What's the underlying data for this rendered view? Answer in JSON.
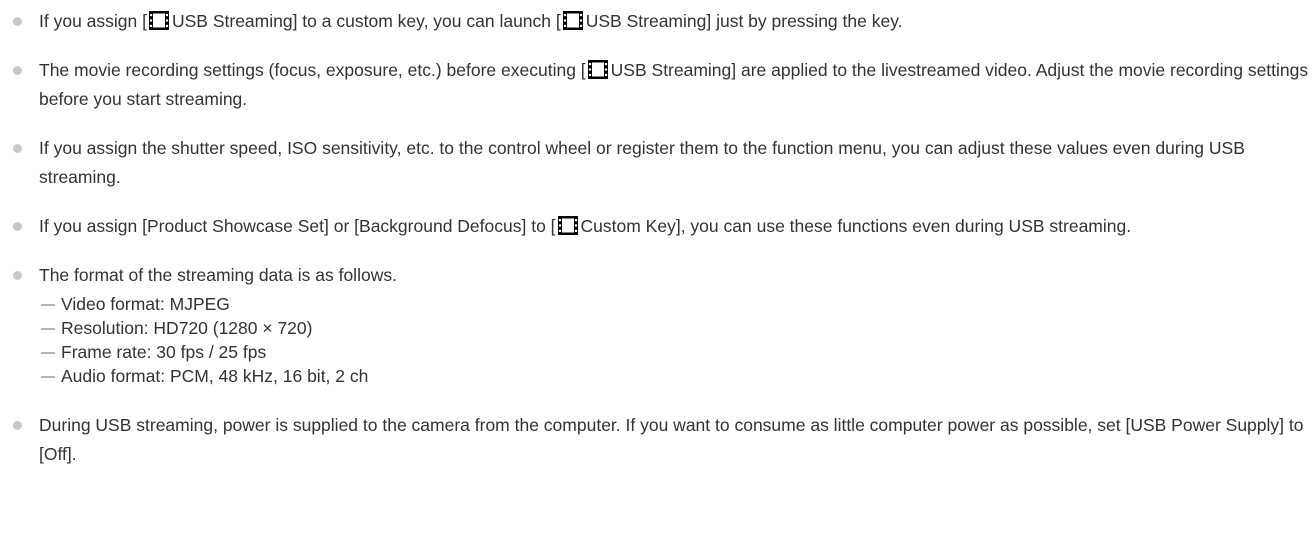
{
  "notes": {
    "n1": {
      "p1": "If you assign [",
      "icon1": "movie-mode-icon",
      "p2": "USB Streaming] to a custom key, you can launch [",
      "icon2": "movie-mode-icon",
      "p3": "USB Streaming] just by pressing the key."
    },
    "n2": {
      "p1": "The movie recording settings (focus, exposure, etc.) before executing [",
      "icon1": "movie-mode-icon",
      "p2": "USB Streaming] are applied to the livestreamed video. Adjust the movie recording settings before you start streaming."
    },
    "n3": {
      "text": "If you assign the shutter speed, ISO sensitivity, etc. to the control wheel or register them to the function menu, you can adjust these values even during USB streaming."
    },
    "n4": {
      "p1": "If you assign [Product Showcase Set] or [Background Defocus] to [",
      "icon1": "movie-mode-icon",
      "p2": "Custom Key], you can use these functions even during USB streaming."
    },
    "n5": {
      "intro": "The format of the streaming data is as follows.",
      "items": [
        "Video format: MJPEG",
        "Resolution: HD720 (1280 × 720)",
        "Frame rate: 30 fps / 25 fps",
        "Audio format: PCM, 48 kHz, 16 bit, 2 ch"
      ]
    },
    "n6": {
      "text": "During USB streaming, power is supplied to the camera from the computer. If you want to consume as little computer power as possible, set [USB Power Supply] to [Off]."
    }
  },
  "colors": {
    "text": "#333333",
    "bullet": "#c8c8c8",
    "dash": "#b5b5b5",
    "icon": "#000000"
  }
}
